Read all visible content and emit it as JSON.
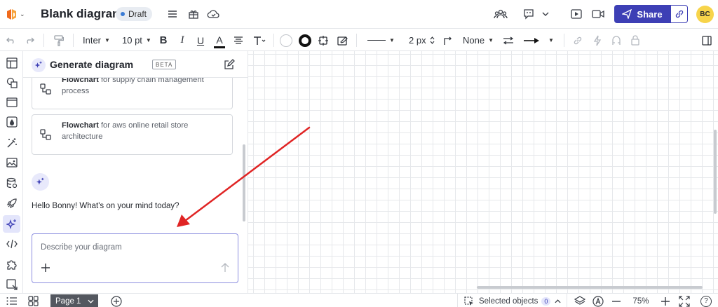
{
  "header": {
    "title": "Blank diagram",
    "status": "Draft",
    "share_label": "Share",
    "avatar_initials": "BC"
  },
  "toolbar": {
    "font_name": "Inter",
    "font_size": "10 pt",
    "bold_label": "B",
    "italic_label": "I",
    "underline_label": "U",
    "text_color_label": "A",
    "line_width": "2 px",
    "line_end": "None"
  },
  "panel": {
    "title": "Generate diagram",
    "beta_label": "BETA",
    "suggestions": [
      {
        "type": "Flowchart",
        "text": "for supply chain management process"
      },
      {
        "type": "Flowchart",
        "text": "for aws online retail store architecture"
      }
    ],
    "greeting": "Hello Bonny! What's on your mind today?",
    "input_placeholder": "Describe your diagram"
  },
  "bottom": {
    "page_label": "Page 1",
    "selected_label": "Selected objects",
    "selected_count": "0",
    "zoom": "75%",
    "help_label": "?"
  },
  "colors": {
    "accent": "#3d3fb5",
    "annotation_arrow": "#e02424",
    "avatar_bg": "#f7d44a"
  }
}
